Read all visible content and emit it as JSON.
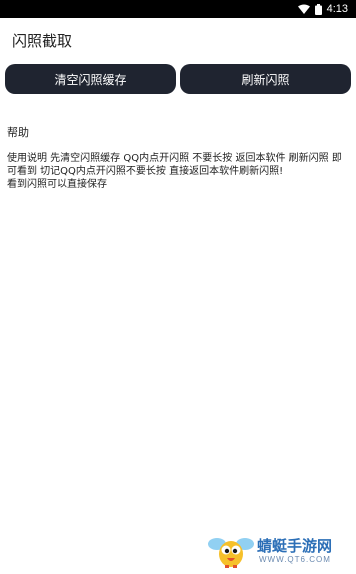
{
  "status_bar": {
    "time": "4:13",
    "wifi_icon": "wifi-icon",
    "battery_icon": "battery-icon"
  },
  "app": {
    "title": "闪照截取"
  },
  "buttons": {
    "clear_label": "清空闪照缓存",
    "refresh_label": "刷新闪照"
  },
  "help": {
    "heading": "帮助",
    "body": "使用说明 先清空闪照缓存 QQ内点开闪照 不要长按 返回本软件 刷新闪照 即可看到 切记QQ内点开闪照不要长按 直接返回本软件刷新闪照!\n看到闪照可以直接保存"
  },
  "watermark": {
    "name": "蜻蜓手游网",
    "url": "WWW.QT6.COM",
    "mascot_icon": "mascot-icon"
  },
  "colors": {
    "button_bg": "#1f2430",
    "button_text": "#ffffff",
    "status_bar_bg": "#000000",
    "watermark_blue": "#2c6fb7"
  }
}
